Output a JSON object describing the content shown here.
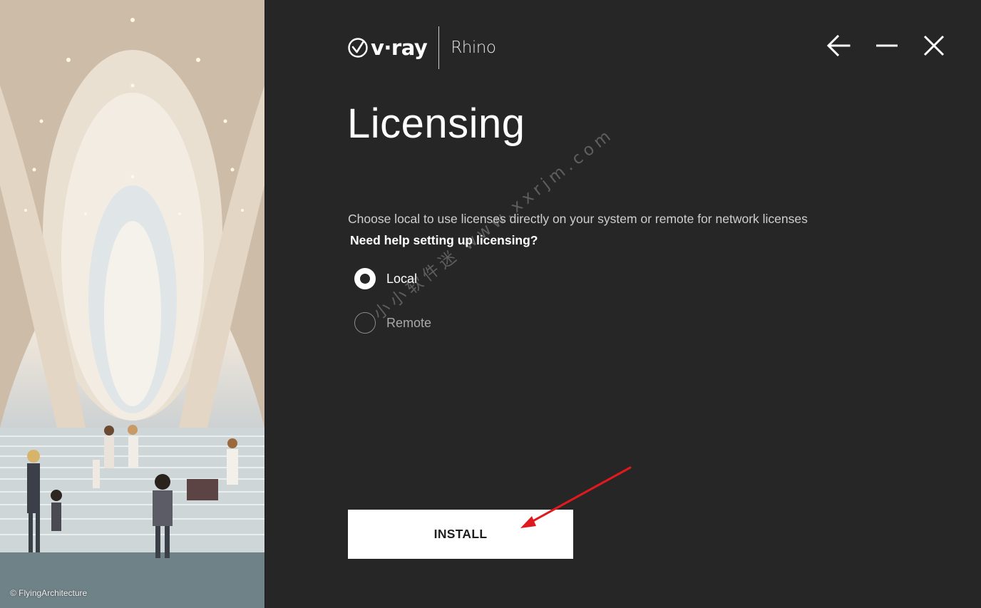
{
  "app": {
    "brand": "v·ray",
    "product": "Rhino"
  },
  "window_controls": {
    "back_icon": "arrow-left-icon",
    "minimize_icon": "minimize-icon",
    "close_icon": "close-icon"
  },
  "hero": {
    "credit": "© FlyingArchitecture"
  },
  "page": {
    "title": "Licensing",
    "description": "Choose local to use licenses directly on your system or remote for network licenses",
    "help_link": "Need help setting up licensing?"
  },
  "license_options": [
    {
      "label": "Local",
      "selected": true
    },
    {
      "label": "Remote",
      "selected": false
    }
  ],
  "watermark": "小小软件迷 www.xxrjm.com",
  "install_button": {
    "label": "INSTALL"
  },
  "colors": {
    "background": "#262626",
    "button_bg": "#ffffff",
    "annotation_arrow": "#e0191f"
  }
}
